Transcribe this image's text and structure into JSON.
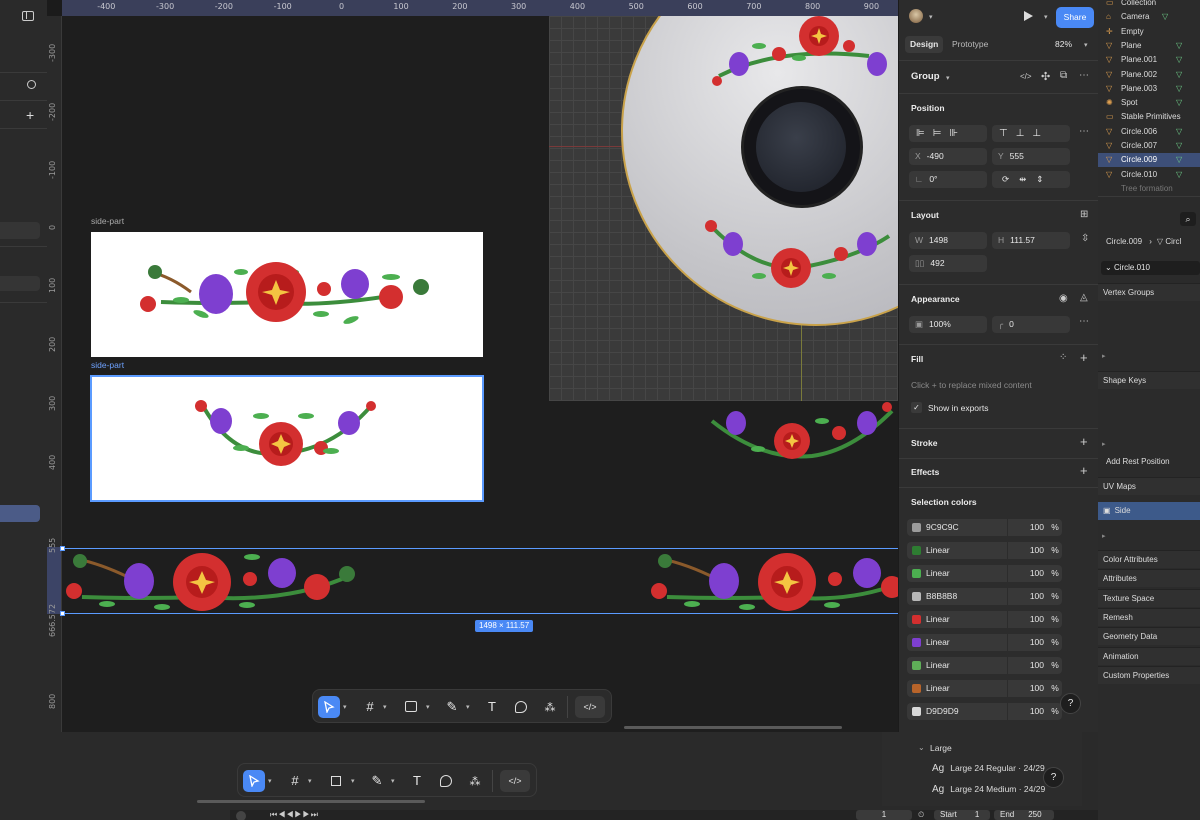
{
  "ruler": {
    "top_ticks": [
      "-400",
      "-300",
      "-200",
      "-100",
      "0",
      "100",
      "200",
      "300",
      "400",
      "500",
      "600",
      "700",
      "800",
      "900"
    ],
    "left_ticks": [
      "-300",
      "-200",
      "-100",
      "0",
      "100",
      "200",
      "300",
      "400",
      "555",
      "666.572",
      "800"
    ]
  },
  "canvas": {
    "frame1_label": "side-part",
    "frame2_label": "side-part",
    "size_badge": "1498 × 111.57"
  },
  "panel": {
    "tabs": {
      "design": "Design",
      "prototype": "Prototype"
    },
    "zoom": "82%",
    "share_label": "Share",
    "group_label": "Group",
    "position": {
      "title": "Position",
      "x_label": "X",
      "x": "-490",
      "y_label": "Y",
      "y": "555",
      "rot": "0°"
    },
    "layout": {
      "title": "Layout",
      "w_label": "W",
      "w": "1498",
      "h_label": "H",
      "h": "111.57",
      "gap": "492"
    },
    "appearance": {
      "title": "Appearance",
      "opacity": "100%",
      "radius": "0"
    },
    "fill": {
      "title": "Fill",
      "hint": "Click + to replace mixed content",
      "show_exports": "Show in exports"
    },
    "stroke_title": "Stroke",
    "effects_title": "Effects",
    "selection_title": "Selection colors",
    "colors": [
      {
        "name": "9C9C9C",
        "pct": "100",
        "swatch": "#9c9c9c"
      },
      {
        "name": "Linear",
        "pct": "100",
        "swatch": "#2e7d32"
      },
      {
        "name": "Linear",
        "pct": "100",
        "swatch": "#4caf50"
      },
      {
        "name": "B8B8B8",
        "pct": "100",
        "swatch": "#b8b8b8"
      },
      {
        "name": "Linear",
        "pct": "100",
        "swatch": "#d32f2f"
      },
      {
        "name": "Linear",
        "pct": "100",
        "swatch": "#7e3fd0"
      },
      {
        "name": "Linear",
        "pct": "100",
        "swatch": "#5fae58"
      },
      {
        "name": "Linear",
        "pct": "100",
        "swatch": "#b8642a"
      },
      {
        "name": "D9D9D9",
        "pct": "100",
        "swatch": "#d9d9d9"
      }
    ],
    "percent_sign": "%",
    "help": "?"
  },
  "blender": {
    "outliner": [
      {
        "label": "Collection",
        "type": "coll"
      },
      {
        "label": "Camera",
        "type": "camera"
      },
      {
        "label": "Empty",
        "type": "empty"
      },
      {
        "label": "Plane",
        "type": "mesh"
      },
      {
        "label": "Plane.001",
        "type": "mesh"
      },
      {
        "label": "Plane.002",
        "type": "mesh"
      },
      {
        "label": "Plane.003",
        "type": "mesh"
      },
      {
        "label": "Spot",
        "type": "light"
      },
      {
        "label": "Stable Primitives",
        "type": "coll"
      },
      {
        "label": "Circle.006",
        "type": "mesh"
      },
      {
        "label": "Circle.007",
        "type": "mesh"
      },
      {
        "label": "Circle.009",
        "type": "mesh"
      },
      {
        "label": "Circle.010",
        "type": "mesh"
      },
      {
        "label": "Tree formation",
        "type": "dim"
      }
    ],
    "breadcrumb_a": "Circle.009",
    "breadcrumb_b": "Circl",
    "mesh_name": "Circle.010",
    "panels": [
      {
        "label": "Vertex Groups"
      },
      {
        "label": "Shape Keys"
      },
      {
        "label": "Add Rest Position"
      },
      {
        "label": "UV Maps"
      },
      {
        "label": "Side"
      },
      {
        "label": "Color Attributes"
      },
      {
        "label": "Attributes"
      },
      {
        "label": "Texture Space"
      },
      {
        "label": "Remesh"
      },
      {
        "label": "Geometry Data"
      },
      {
        "label": "Animation"
      },
      {
        "label": "Custom Properties"
      }
    ]
  },
  "bottom": {
    "group_label": "Large",
    "styles": [
      {
        "ag": "Ag",
        "name": "Large 24 Regular · 24/29"
      },
      {
        "ag": "Ag",
        "name": "Large 24 Medium · 24/29"
      }
    ],
    "timeline": {
      "frame": "1",
      "start_label": "Start",
      "start": "1",
      "end_label": "End",
      "end": "250"
    }
  }
}
